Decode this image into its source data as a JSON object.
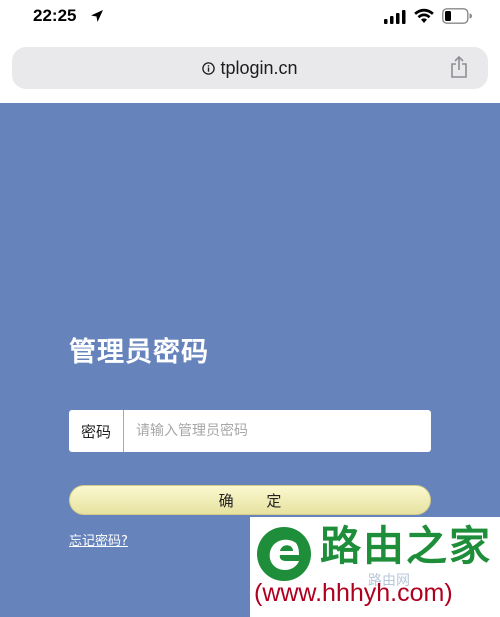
{
  "status_bar": {
    "time": "22:25",
    "icons": [
      "location-arrow-icon",
      "cellular-signal-icon",
      "wifi-icon",
      "battery-icon"
    ]
  },
  "browser": {
    "url": "tplogin.cn",
    "info_icon": "info-icon",
    "share_icon": "share-icon"
  },
  "login": {
    "title": "管理员密码",
    "password_label": "密码",
    "password_placeholder": "请输入管理员密码",
    "password_value": "",
    "confirm_label": "确 定",
    "forgot_label": "忘记密码?"
  },
  "watermark": {
    "brand": "路由之家",
    "sub_text": "路由网",
    "url": "(www.hhhyh.com)"
  },
  "colors": {
    "page_background": "#6683bb",
    "button_background": "#f1edb8",
    "watermark_green": "#1f8e3a",
    "watermark_red": "#b00020"
  }
}
